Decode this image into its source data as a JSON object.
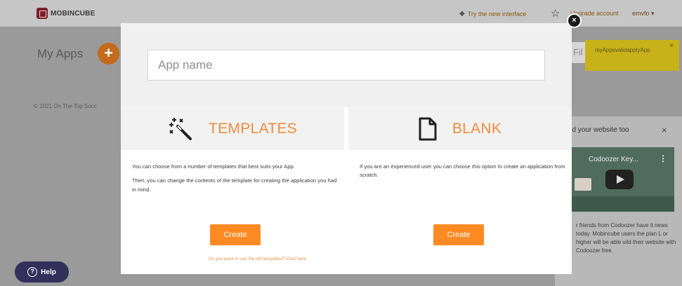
{
  "topbar": {
    "logo_text": "MOBINCUBE",
    "interface_link": "Try the new interface",
    "account_link": "Upgrade account",
    "user_menu": "emvfo ▾"
  },
  "main": {
    "title": "My Apps",
    "add_button": "+",
    "copyright": "© 2021 On The Top Succ"
  },
  "toast": {
    "message": "myAppsvalidapplyApp",
    "close": "×"
  },
  "filter_stub": "Fil",
  "promo": {
    "title": "ild your website too",
    "close": "×",
    "video_title": "Codoozer Key...",
    "video_menu": "⋮",
    "text": "r friends from Codoozer have it news today. Mobincube users the plan L or higher will be able uild their website with Codoozer free."
  },
  "help": {
    "label": "Help",
    "icon_glyph": "?"
  },
  "modal": {
    "close_glyph": "×",
    "app_name_placeholder": "App name",
    "app_name_value": "",
    "templates": {
      "title": "TEMPLATES",
      "icon": "magic-wand-icon",
      "desc_1": "You can choose from a number of templates that best suits your App.",
      "desc_2": "Then, you can change the contents of the template for creating the application you had in mind.",
      "create_label": "Create",
      "old_templates_link": "Do you want to use the old templates? Click here"
    },
    "blank": {
      "title": "BLANK",
      "icon": "blank-document-icon",
      "desc_1": "If you are an experienced user you can choose this option to create an application from scratch.",
      "create_label": "Create"
    }
  },
  "colors": {
    "accent": "#ff8a23",
    "title_orange": "#f08b3c",
    "help_bg": "#33305c",
    "toast_bg": "#c7b21a"
  }
}
